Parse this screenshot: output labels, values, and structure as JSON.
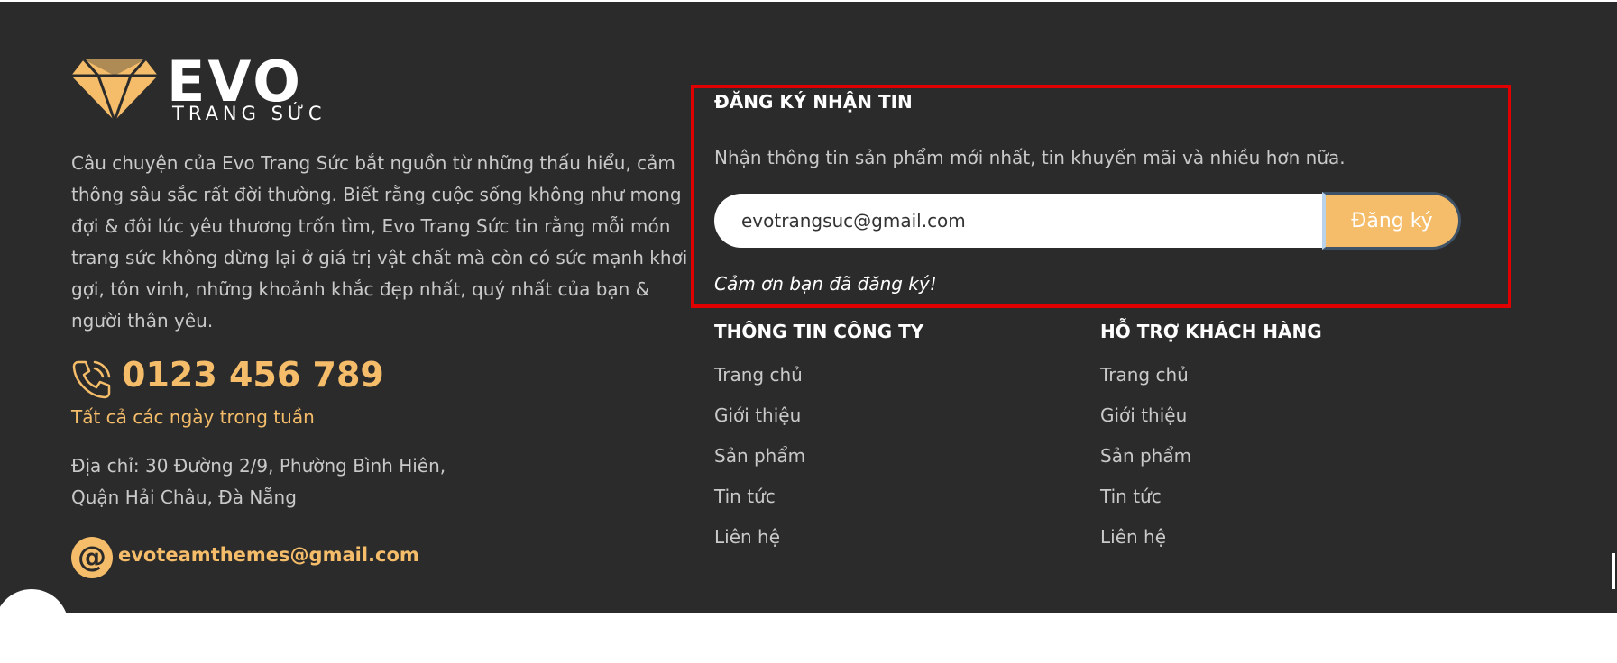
{
  "brand": {
    "name": "EVO",
    "tagline": "TRANG SỨC"
  },
  "about": "Câu chuyện của Evo Trang Sức bắt nguồn từ những thấu hiểu, cảm thông sâu sắc rất đời thường. Biết rằng cuộc sống không như mong đợi & đôi lúc yêu thương trốn tìm, Evo Trang Sức tin rằng mỗi món trang sức không dừng lại ở giá trị vật chất mà còn có sức mạnh khơi gợi, tôn vinh, những khoảnh khắc đẹp nhất, quý nhất của bạn & người thân yêu.",
  "contact": {
    "phone": "0123 456 789",
    "days": "Tất cả các ngày trong tuần",
    "address_line1": "Địa chỉ: 30 Đường 2/9, Phường Bình Hiên,",
    "address_line2": "Quận Hải Châu, Đà Nẵng",
    "email": "evoteamthemes@gmail.com"
  },
  "newsletter": {
    "title": "ĐĂNG KÝ NHẬN TIN",
    "description": "Nhận thông tin sản phẩm mới nhất, tin khuyến mãi và nhiều hơn nữa.",
    "input_value": "evotrangsuc@gmail.com",
    "button_label": "Đăng ký",
    "thanks": "Cảm ơn bạn đã đăng ký!"
  },
  "company_info": {
    "title": "THÔNG TIN CÔNG TY",
    "links": [
      "Trang chủ",
      "Giới thiệu",
      "Sản phẩm",
      "Tin tức",
      "Liên hệ"
    ]
  },
  "support": {
    "title": "HỖ TRỢ KHÁCH HÀNG",
    "links": [
      "Trang chủ",
      "Giới thiệu",
      "Sản phẩm",
      "Tin tức",
      "Liên hệ"
    ]
  },
  "colors": {
    "background": "#2b2b2b",
    "accent": "#f5bd6a",
    "highlight_border": "#e00000"
  },
  "icons": [
    "diamond-logo-icon",
    "phone-icon",
    "at-sign-icon"
  ]
}
